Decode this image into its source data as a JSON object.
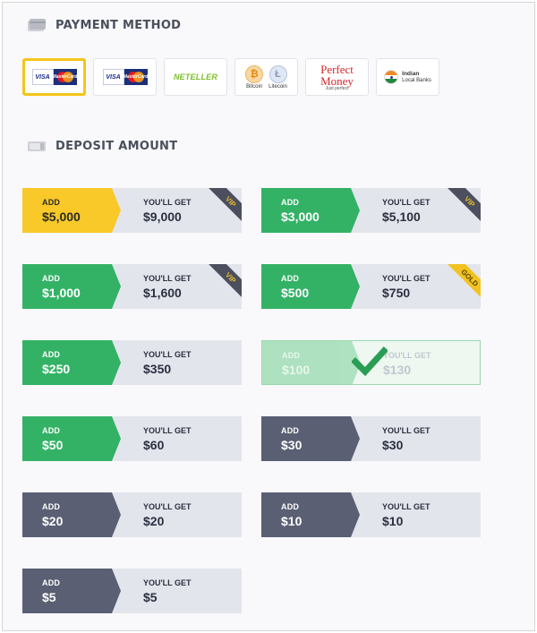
{
  "payment_section": {
    "title": "PAYMENT METHOD",
    "methods": [
      {
        "id": "visa-mastercard-1",
        "visa": "VISA",
        "mc": "MasterCard",
        "selected": true
      },
      {
        "id": "visa-mastercard-2",
        "visa": "VISA",
        "mc": "MasterCard",
        "selected": false
      },
      {
        "id": "neteller",
        "label": "NETELLER",
        "selected": false
      },
      {
        "id": "crypto",
        "bitcoin": "Bitcoin",
        "litecoin": "Litecoin",
        "btc_symbol": "₿",
        "ltc_symbol": "Ł",
        "selected": false
      },
      {
        "id": "perfect-money",
        "line1": "Perfect",
        "line2": "Money",
        "tagline": "Just perfect",
        "selected": false
      },
      {
        "id": "indian-banks",
        "line1": "Indian",
        "line2": "Local Banks",
        "selected": false
      }
    ]
  },
  "deposit_section": {
    "title": "DEPOSIT AMOUNT",
    "add_label": "ADD",
    "get_label": "YOU'LL GET",
    "offers": [
      {
        "add": "$5,000",
        "get": "$9,000",
        "color": "yellow",
        "badge": "VIP"
      },
      {
        "add": "$3,000",
        "get": "$5,100",
        "color": "green",
        "badge": "VIP"
      },
      {
        "add": "$1,000",
        "get": "$1,600",
        "color": "green",
        "badge": "VIP"
      },
      {
        "add": "$500",
        "get": "$750",
        "color": "green",
        "badge": "GOLD"
      },
      {
        "add": "$250",
        "get": "$350",
        "color": "green",
        "badge": ""
      },
      {
        "add": "$100",
        "get": "$130",
        "color": "green",
        "badge": "",
        "selected": true
      },
      {
        "add": "$50",
        "get": "$60",
        "color": "green",
        "badge": ""
      },
      {
        "add": "$30",
        "get": "$30",
        "color": "slate",
        "badge": ""
      },
      {
        "add": "$20",
        "get": "$20",
        "color": "slate",
        "badge": ""
      },
      {
        "add": "$10",
        "get": "$10",
        "color": "slate",
        "badge": ""
      },
      {
        "add": "$5",
        "get": "$5",
        "color": "slate",
        "badge": ""
      }
    ]
  },
  "colors": {
    "yellow": "#f8c928",
    "green": "#33b266",
    "slate": "#5a5f73",
    "selected_border": "#f5c518",
    "card_bg": "#e3e5ec"
  }
}
